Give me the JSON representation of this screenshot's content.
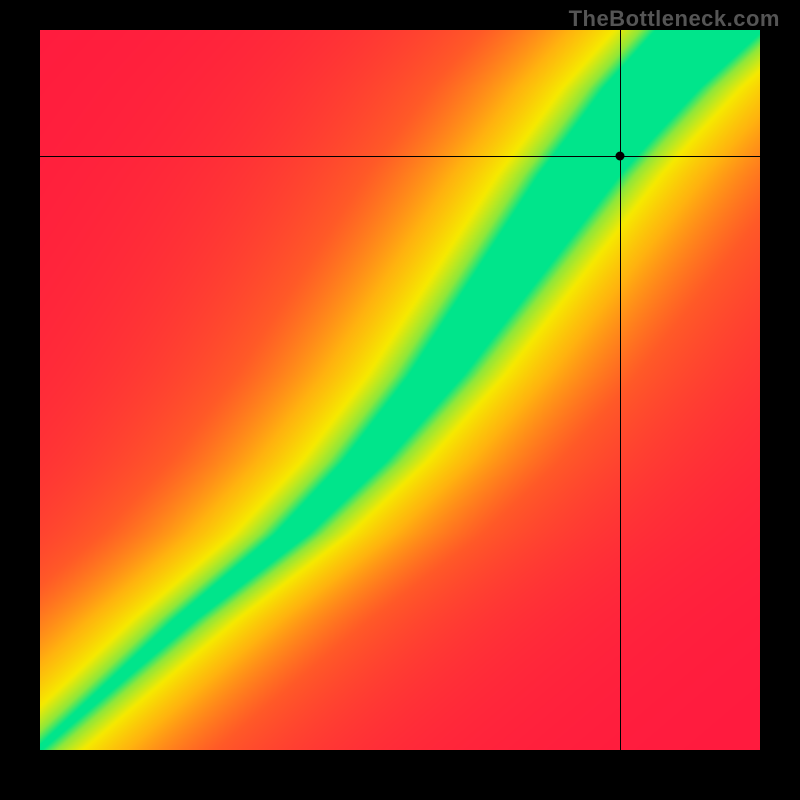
{
  "watermark": "TheBottleneck.com",
  "chart_data": {
    "type": "heatmap",
    "title": "",
    "xlabel": "",
    "ylabel": "",
    "xlim": [
      0,
      1
    ],
    "ylim": [
      0,
      1
    ],
    "grid": false,
    "color_scale": {
      "stops": [
        {
          "t": 0.0,
          "color": "#ff193f"
        },
        {
          "t": 0.3,
          "color": "#ff5a27"
        },
        {
          "t": 0.55,
          "color": "#ffb20f"
        },
        {
          "t": 0.75,
          "color": "#f6e900"
        },
        {
          "t": 0.9,
          "color": "#8fe73a"
        },
        {
          "t": 1.0,
          "color": "#00e58b"
        }
      ],
      "meaning": "red = worst match, green = optimal match"
    },
    "ridge": {
      "type": "nonlinear diagonal curve",
      "description": "narrow green optimal band curving from lower-left toward upper-right; outside it fades through yellow/orange to red",
      "control_points_xy": [
        [
          0.02,
          0.02
        ],
        [
          0.2,
          0.18
        ],
        [
          0.35,
          0.3
        ],
        [
          0.45,
          0.4
        ],
        [
          0.55,
          0.52
        ],
        [
          0.65,
          0.66
        ],
        [
          0.75,
          0.8
        ],
        [
          0.85,
          0.92
        ],
        [
          0.93,
          1.0
        ]
      ],
      "halfwidth_at_y": [
        {
          "y": 0.0,
          "w": 0.005
        },
        {
          "y": 0.1,
          "w": 0.01
        },
        {
          "y": 0.25,
          "w": 0.02
        },
        {
          "y": 0.4,
          "w": 0.03
        },
        {
          "y": 0.55,
          "w": 0.04
        },
        {
          "y": 0.7,
          "w": 0.05
        },
        {
          "y": 0.85,
          "w": 0.06
        },
        {
          "y": 1.0,
          "w": 0.075
        }
      ]
    },
    "crosshair": {
      "x": 0.805,
      "y": 0.825,
      "relation_to_ridge": "just right of green band, in yellow-green transition"
    }
  }
}
